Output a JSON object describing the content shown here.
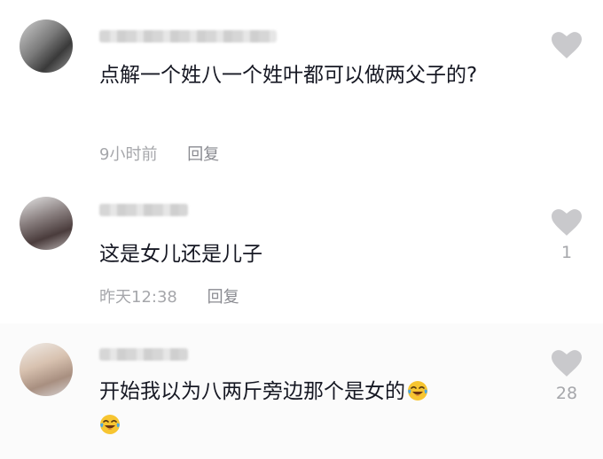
{
  "comments": [
    {
      "text": "点解一个姓八一个姓叶都可以做两父子的?",
      "time": "9小时前",
      "reply_label": "回复",
      "likes": ""
    },
    {
      "text": "这是女儿还是儿子",
      "time": "昨天12:38",
      "reply_label": "回复",
      "likes": "1"
    },
    {
      "text": "开始我以为八两斤旁边那个是女的",
      "likes": "28"
    }
  ],
  "icons": {
    "like": "heart-icon",
    "emoji": "laughing-tears-emoji"
  },
  "colors": {
    "text": "#161823",
    "meta": "#a6a7ab",
    "heart": "#c9c9cc"
  }
}
